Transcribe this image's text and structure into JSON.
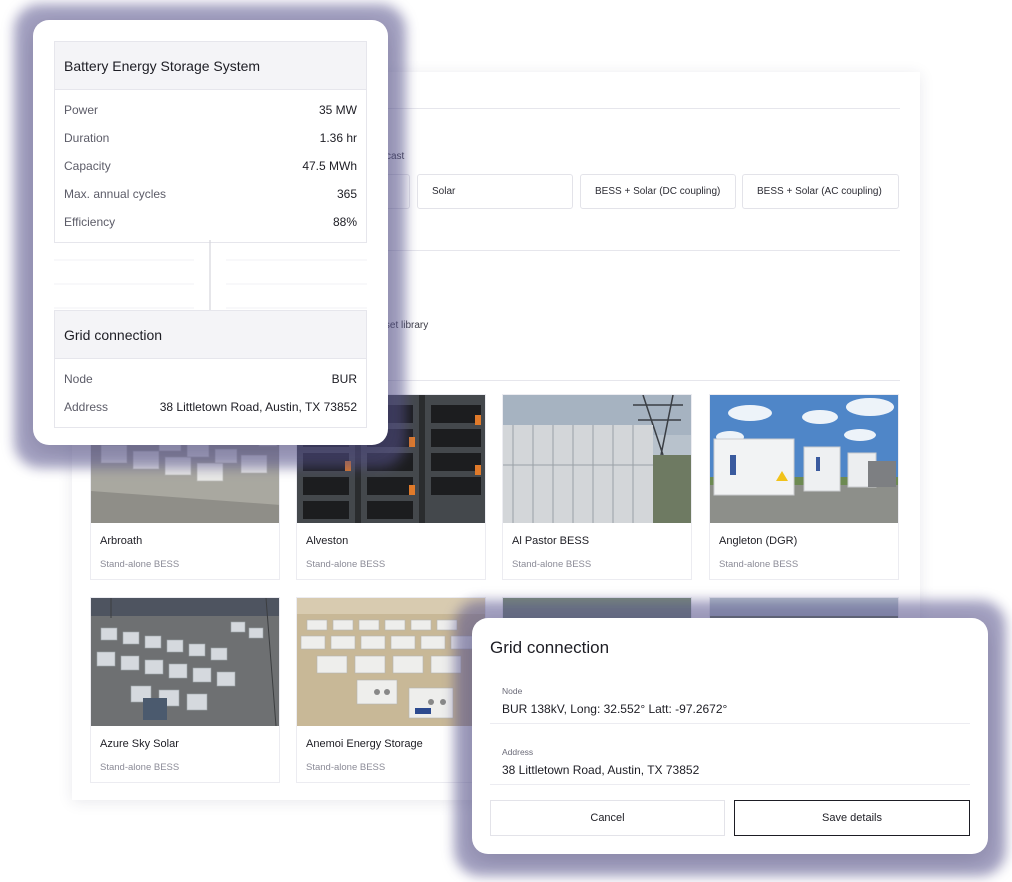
{
  "asset_types": {
    "fragment_forecast": "cast",
    "options": [
      {
        "label": "Solar"
      },
      {
        "label": "BESS + Solar (DC coupling)"
      },
      {
        "label": "BESS + Solar (AC coupling)"
      }
    ]
  },
  "library": {
    "fragment_text": "n asset library",
    "cards": [
      {
        "name": "Arbroath",
        "kind": "Stand-alone BESS"
      },
      {
        "name": "Alveston",
        "kind": "Stand-alone BESS"
      },
      {
        "name": "Al Pastor BESS",
        "kind": "Stand-alone BESS"
      },
      {
        "name": "Angleton (DGR)",
        "kind": "Stand-alone BESS"
      },
      {
        "name": "Azure Sky Solar",
        "kind": "Stand-alone BESS"
      },
      {
        "name": "Anemoi Energy Storage",
        "kind": "Stand-alone BESS"
      }
    ]
  },
  "summary": {
    "bess": {
      "title": "Battery Energy Storage System",
      "rows": [
        {
          "label": "Power",
          "value": "35 MW"
        },
        {
          "label": "Duration",
          "value": "1.36 hr"
        },
        {
          "label": "Capacity",
          "value": "47.5 MWh"
        },
        {
          "label": "Max. annual cycles",
          "value": "365"
        },
        {
          "label": "Efficiency",
          "value": "88%"
        }
      ]
    },
    "grid": {
      "title": "Grid connection",
      "rows": [
        {
          "label": "Node",
          "value": "BUR"
        },
        {
          "label": "Address",
          "value": "38 Littletown Road, Austin, TX 73852"
        }
      ]
    }
  },
  "modal": {
    "title": "Grid connection",
    "node": {
      "label": "Node",
      "value": "BUR 138kV, Long: 32.552° Latt: -97.2672°"
    },
    "address": {
      "label": "Address",
      "value": "38 Littletown Road, Austin, TX 73852"
    },
    "cancel_label": "Cancel",
    "save_label": "Save details"
  }
}
